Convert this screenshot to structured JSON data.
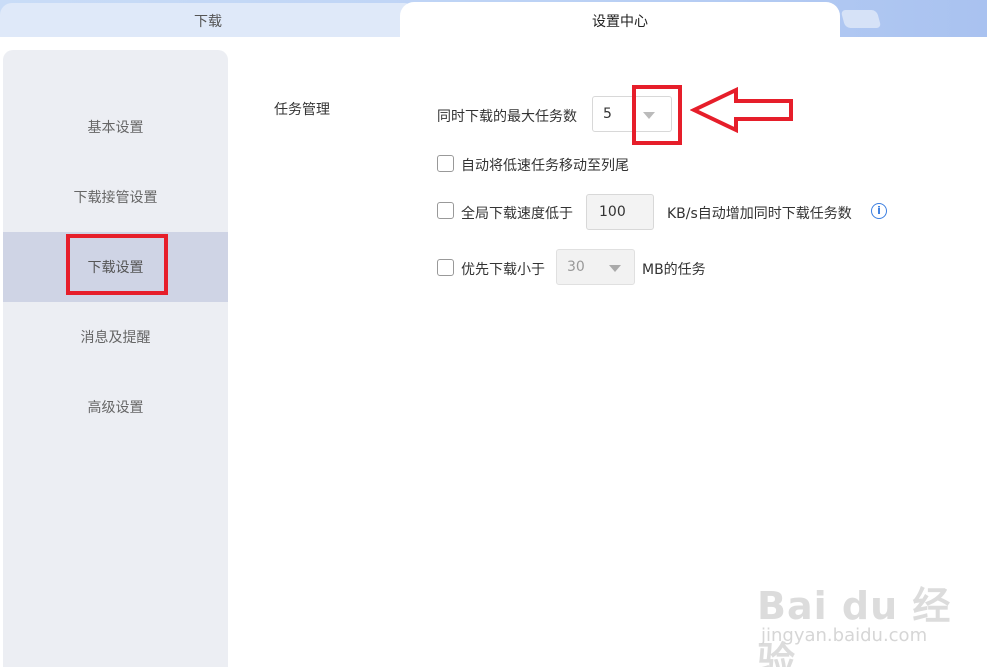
{
  "tabs": [
    {
      "label": "下载",
      "active": false
    },
    {
      "label": "设置中心",
      "active": true
    }
  ],
  "sidebar": {
    "items": [
      {
        "label": "基本设置",
        "active": false
      },
      {
        "label": "下载接管设置",
        "active": false
      },
      {
        "label": "下载设置",
        "active": true
      },
      {
        "label": "消息及提醒",
        "active": false
      },
      {
        "label": "高级设置",
        "active": false
      }
    ]
  },
  "task_management": {
    "title": "任务管理",
    "max_tasks": {
      "label": "同时下载的最大任务数",
      "value": "5"
    },
    "auto_move_slow": {
      "label": "自动将低速任务移动至列尾",
      "checked": false
    },
    "speed_threshold": {
      "label_before": "全局下载速度低于",
      "value": "100",
      "label_after": "KB/s自动增加同时下载任务数",
      "checked": false
    },
    "prioritize_small": {
      "label_before": "优先下载小于",
      "value": "30",
      "label_after": "MB的任务",
      "checked": false
    }
  },
  "watermark": {
    "brand": "Bai du 经验",
    "url": "jingyan.baidu.com"
  },
  "colors": {
    "highlight": "#e61e2a",
    "accent": "#3d7fe0",
    "sidebar_active": "#cfd4e5"
  }
}
